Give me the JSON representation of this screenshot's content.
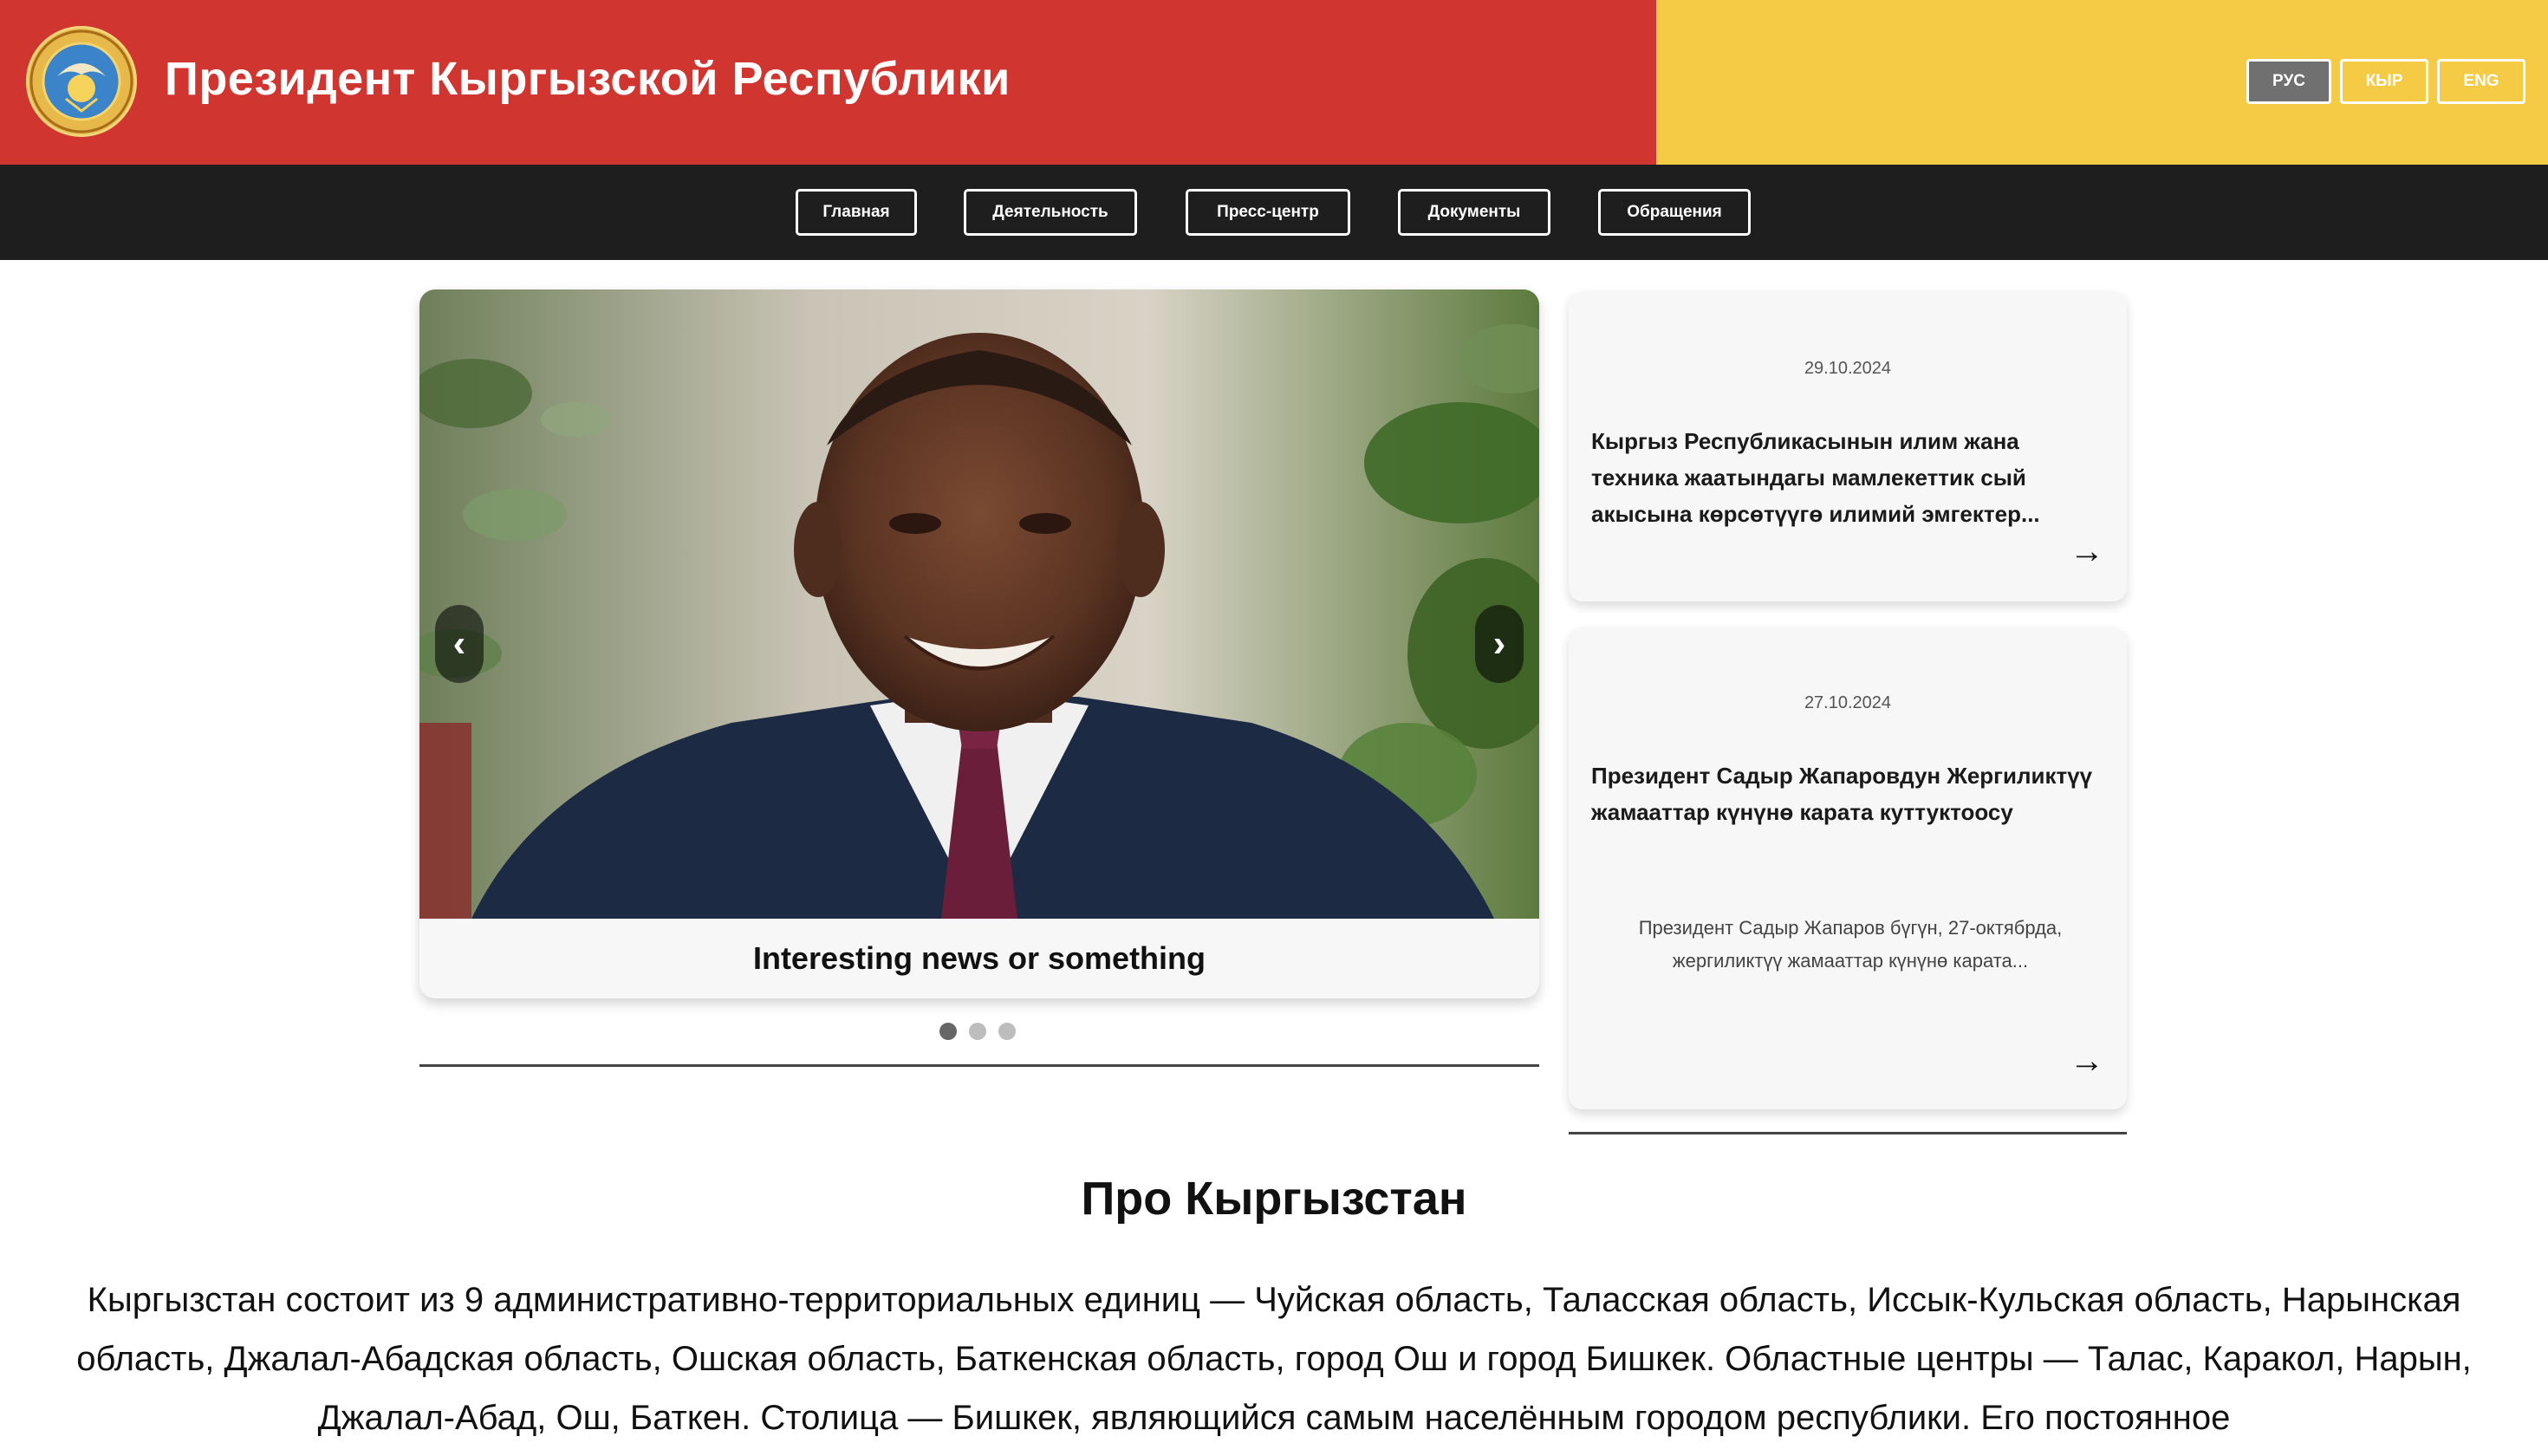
{
  "header": {
    "title": "Президент Кыргызской Республики",
    "colors": {
      "red": "#d13530",
      "yellow": "#f5cb45"
    },
    "emblem_icon": "state-emblem-icon"
  },
  "languages": [
    {
      "label": "РУС",
      "active": true
    },
    {
      "label": "КЫР",
      "active": false
    },
    {
      "label": "ENG",
      "active": false
    }
  ],
  "nav": {
    "items": [
      {
        "label": "Главная"
      },
      {
        "label": "Деятельность"
      },
      {
        "label": "Пресс-центр"
      },
      {
        "label": "Документы"
      },
      {
        "label": "Обращения"
      }
    ]
  },
  "slider": {
    "caption": "Interesting news or something",
    "prev_label": "‹",
    "next_label": "›",
    "slide_count": 3,
    "active_index": 0
  },
  "news": [
    {
      "date": "29.10.2024",
      "title": "Кыргыз Республикасынын илим жана техника жаатындагы мамлекеттик сый акысына көрсөтүүгө илимий эмгектер...",
      "excerpt": "",
      "arrow": "→"
    },
    {
      "date": "27.10.2024",
      "title": "Президент Садыр Жапаровдун Жергиликтүү жамааттар күнүнө карата куттуктоосу",
      "excerpt": "Президент Садыр Жапаров бүгүн, 27-октябрда, жергиликтүү жамааттар күнүнө карата...",
      "arrow": "→"
    }
  ],
  "about": {
    "title": "Про Кыргызстан",
    "text": "Кыргызстан состоит из 9 административно-территориальных единиц — Чуйская область, Таласская область, Иссык-Кульская область, Нарынская область, Джалал-Абадская область, Ошская область, Баткенская область, город Ош и город Бишкек. Областные центры — Талас, Каракол, Нарын, Джалал-Абад, Ош, Баткен. Столица — Бишкек, являющийся самым населённым городом республики. Его постоянное"
  }
}
